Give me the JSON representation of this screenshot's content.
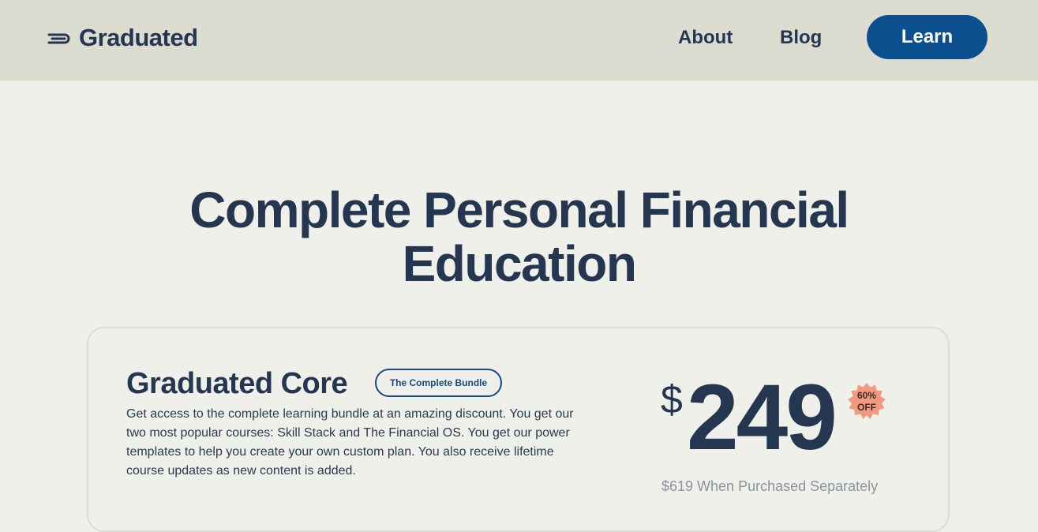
{
  "header": {
    "logo_text": "Graduated",
    "nav": {
      "about": "About",
      "blog": "Blog"
    },
    "cta_label": "Learn"
  },
  "hero": {
    "title_line1": "Complete Personal Financial",
    "title_line2": "Education"
  },
  "product": {
    "title": "Graduated Core",
    "badge": "The Complete Bundle",
    "description": "Get access to the complete learning bundle at an amazing discount. You get our two most popular courses: Skill Stack and The Financial OS. You get our power templates to help you create your own custom plan. You also receive lifetime course updates as new content is added.",
    "price_symbol": "$",
    "price": "249",
    "discount_line1": "60%",
    "discount_line2": "OFF",
    "separate_price_note": "$619 When Purchased Separately"
  },
  "colors": {
    "header_bg": "#dddcd1",
    "page_bg": "#f0f0eb",
    "primary_text": "#243650",
    "cta_bg": "#0c4f8e",
    "discount_bg": "#f29a80"
  },
  "icons": {
    "logo": "graduated-lines-logo-icon"
  }
}
